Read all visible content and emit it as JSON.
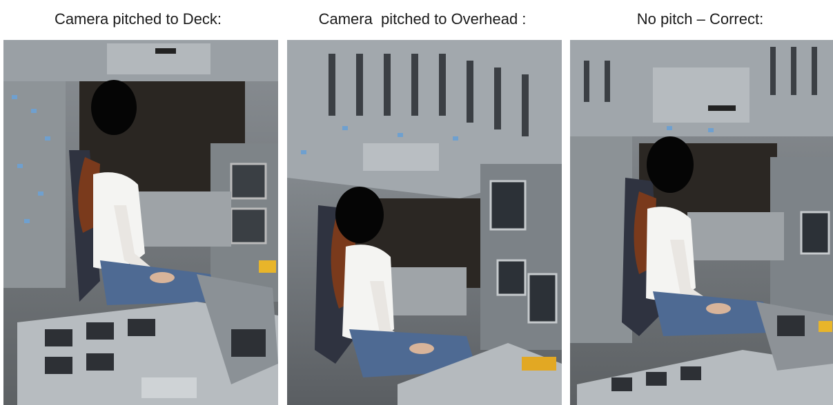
{
  "captions": {
    "deck": "Camera pitched to Deck:",
    "overhead": "Camera  pitched to Overhead :",
    "correct": "No pitch – Correct:"
  },
  "photos": [
    {
      "name": "cockpit-photo-deck-pitch",
      "subject": "seated crew member in shuttle flight deck, face obscured"
    },
    {
      "name": "cockpit-photo-overhead-pitch",
      "subject": "seated crew member in shuttle flight deck, face obscured"
    },
    {
      "name": "cockpit-photo-no-pitch",
      "subject": "seated crew member in shuttle flight deck, face obscured"
    }
  ]
}
